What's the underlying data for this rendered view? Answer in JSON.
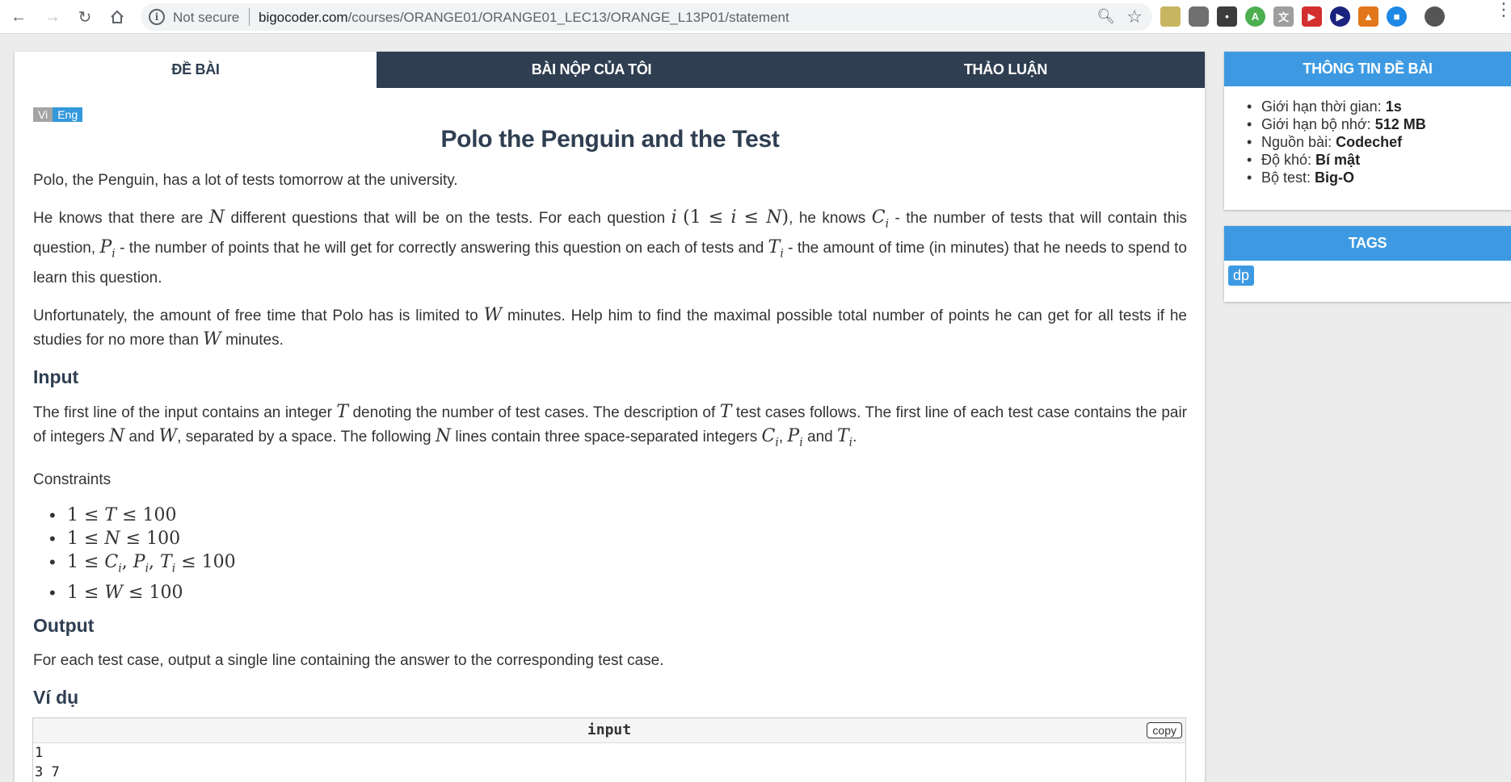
{
  "browser": {
    "security_label": "Not secure",
    "url_host": "bigocoder.com",
    "url_path": "/courses/ORANGE01/ORANGE01_LEC13/ORANGE_L13P01/statement"
  },
  "tabs": [
    {
      "label": "ĐỀ BÀI"
    },
    {
      "label": "BÀI NỘP CỦA TÔI"
    },
    {
      "label": "THẢO LUẬN"
    }
  ],
  "language": {
    "vi": "Vi",
    "en": "Eng"
  },
  "problem": {
    "title": "Polo the Penguin and the Test",
    "intro": "Polo, the Penguin, has a lot of tests tomorrow at the university.",
    "input_heading": "Input",
    "constraints_label": "Constraints",
    "output_heading": "Output",
    "output_text": "For each test case, output a single line containing the answer to the corresponding test case.",
    "example_heading": "Ví dụ"
  },
  "sample": {
    "header": "input",
    "copy_label": "copy",
    "lines": [
      "1",
      "3 7"
    ]
  },
  "info": {
    "heading": "THÔNG TIN ĐỀ BÀI",
    "items": [
      {
        "label": "Giới hạn thời gian: ",
        "value": "1s"
      },
      {
        "label": "Giới hạn bộ nhớ: ",
        "value": "512 MB"
      },
      {
        "label": "Nguồn bài: ",
        "value": "Codechef"
      },
      {
        "label": "Độ khó: ",
        "value": "Bí mật"
      },
      {
        "label": "Bộ test: ",
        "value": "Big-O"
      }
    ]
  },
  "tags": {
    "heading": "TAGS",
    "items": [
      "dp"
    ]
  }
}
